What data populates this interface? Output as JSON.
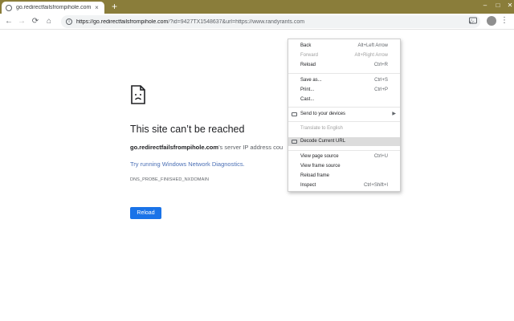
{
  "browser": {
    "tab_title": "go.redirectfailsfrompihole.com",
    "tab_close": "×",
    "new_tab": "+",
    "window_controls": {
      "minimize": "–",
      "maximize": "□",
      "close": "✕"
    },
    "accent_color": "#8a7d3a",
    "url_host": "https://go.redirectfailsfrompihole.com",
    "url_rest": "/?id=9427TX1548637&url=https://www.randyrants.com",
    "nav": {
      "back": "←",
      "forward": "→",
      "reload": "⟳",
      "home": "⌂"
    },
    "star": "☆",
    "menu": "⋮"
  },
  "error_page": {
    "title": "This site can’t be reached",
    "host": "go.redirectfailsfrompihole.com",
    "message_suffix": "’s server IP address cou",
    "diagnostics_link": "Try running Windows Network Diagnostics.",
    "error_code": "DNS_PROBE_FINISHED_NXDOMAIN",
    "reload_button": "Reload",
    "button_color": "#1a73e8"
  },
  "context_menu": {
    "items": [
      {
        "label": "Back",
        "shortcut": "Alt+Left Arrow",
        "disabled": false
      },
      {
        "label": "Forward",
        "shortcut": "Alt+Right Arrow",
        "disabled": true
      },
      {
        "label": "Reload",
        "shortcut": "Ctrl+R",
        "disabled": false
      },
      {
        "label": "Save as...",
        "shortcut": "Ctrl+S",
        "disabled": false
      },
      {
        "label": "Print...",
        "shortcut": "Ctrl+P",
        "disabled": false
      },
      {
        "label": "Cast...",
        "shortcut": "",
        "disabled": false
      },
      {
        "label": "Send to your devices",
        "shortcut": "",
        "disabled": false
      },
      {
        "label": "Translate to English",
        "shortcut": "",
        "disabled": true
      },
      {
        "label": "Decode Current URL",
        "shortcut": "",
        "disabled": false
      },
      {
        "label": "View page source",
        "shortcut": "Ctrl+U",
        "disabled": false
      },
      {
        "label": "View frame source",
        "shortcut": "",
        "disabled": false
      },
      {
        "label": "Reload frame",
        "shortcut": "",
        "disabled": false
      },
      {
        "label": "Inspect",
        "shortcut": "Ctrl+Shift+I",
        "disabled": false
      }
    ],
    "submenu_arrow": "▶"
  }
}
